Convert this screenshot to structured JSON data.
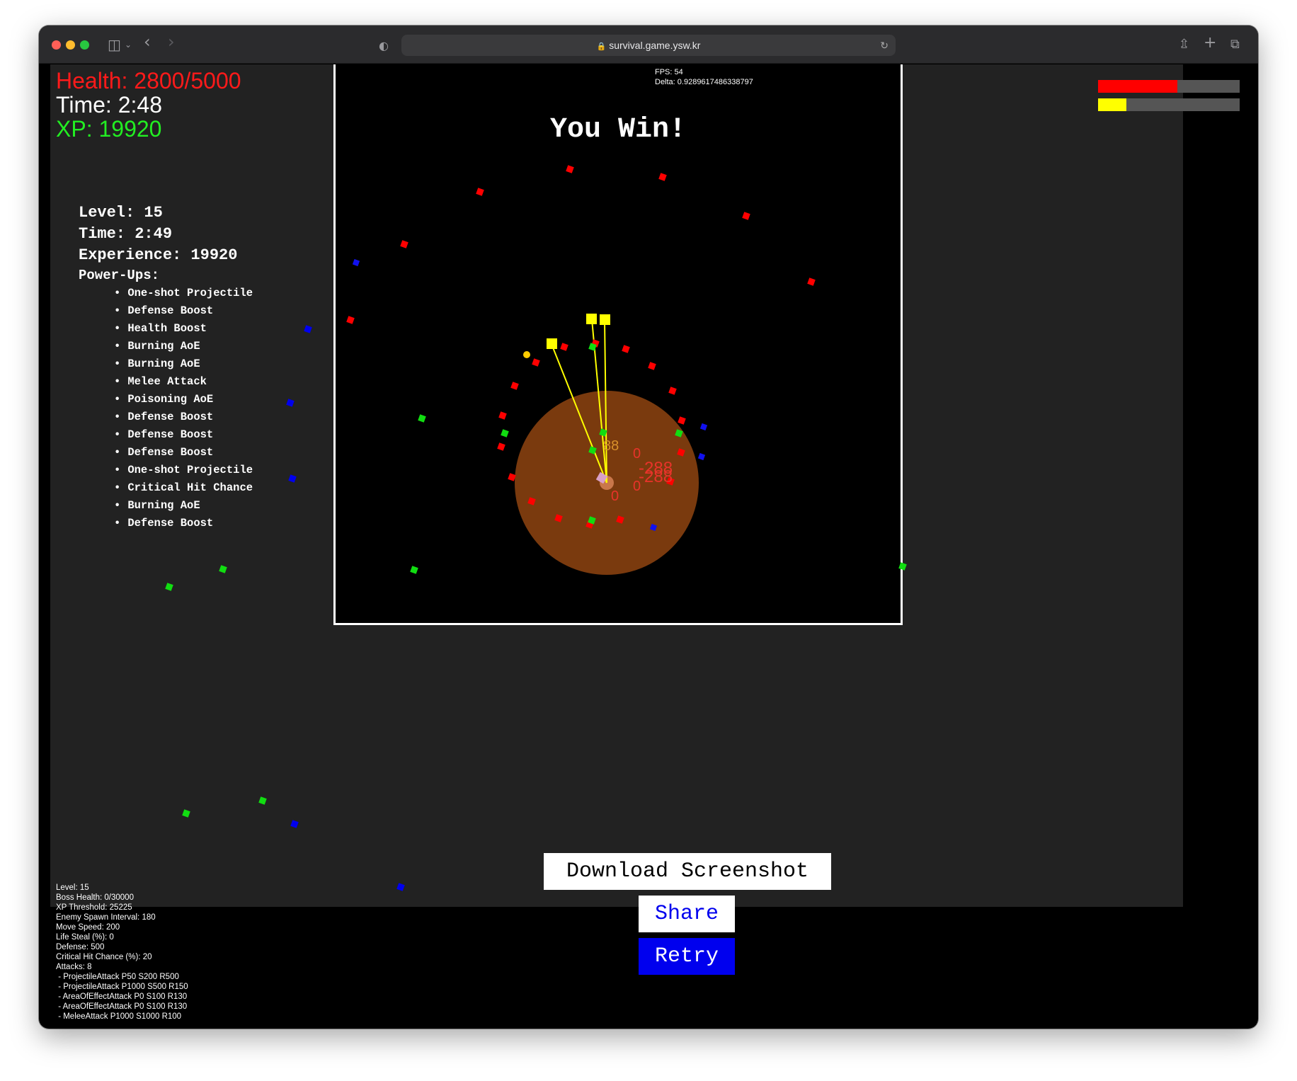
{
  "browser": {
    "url": "survival.game.ysw.kr"
  },
  "hud": {
    "health": "Health: 2800/5000",
    "time": "Time: 2:48",
    "xp": "XP: 19920",
    "health_color": "#ff1a1a",
    "time_color": "#ffffff",
    "xp_color": "#22ee22",
    "health_bar_fraction": 0.56,
    "xp_bar_fraction": 0.2
  },
  "debug_top": {
    "fps": "FPS: 54",
    "delta": "Delta: 0.9289617486338797"
  },
  "result": {
    "title": "You Win!"
  },
  "summary": {
    "level": "Level: 15",
    "time": "Time: 2:49",
    "experience": "Experience: 19920",
    "powerups_title": "Power-Ups:",
    "powerups": [
      "One-shot Projectile",
      "Defense Boost",
      "Health Boost",
      "Burning AoE",
      "Burning AoE",
      "Melee Attack",
      "Poisoning AoE",
      "Defense Boost",
      "Defense Boost",
      "Defense Boost",
      "One-shot Projectile",
      "Critical Hit Chance",
      "Burning AoE",
      "Defense Boost"
    ]
  },
  "damage_numbers": [
    "0",
    "-288",
    "-288",
    "0",
    "0",
    "88"
  ],
  "buttons": {
    "download": "Download Screenshot",
    "share": "Share",
    "retry": "Retry"
  },
  "debug_bottom": [
    "Level: 15",
    "Boss Health: 0/30000",
    "XP Threshold: 25225",
    "Enemy Spawn Interval: 180",
    "Move Speed: 200",
    "Life Steal (%): 0",
    "Defense: 500",
    "Critical Hit Chance (%): 20",
    "Attacks: 8",
    " - ProjectileAttack P50 S200 R500",
    " - ProjectileAttack P1000 S500 R150",
    " - AreaOfEffectAttack P0 S100 R130",
    " - AreaOfEffectAttack P0 S100 R130",
    " - MeleeAttack P1000 S1000 R100"
  ]
}
